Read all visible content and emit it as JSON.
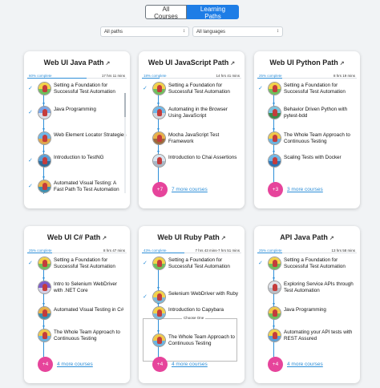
{
  "toggle": {
    "all_courses": "All Courses",
    "learning_paths": "Learning Paths"
  },
  "filters": {
    "paths": "All paths",
    "languages": "All languages"
  },
  "cards": [
    {
      "title": "Web UI Java Path",
      "complete": "60% complete",
      "progress": 0.6,
      "duration": "17 hrs 11 mins",
      "courses": [
        {
          "name": "Setting a Foundation for Successful Test Automation",
          "done": true,
          "top": "#f2d24a",
          "bot": "#6fbf5b"
        },
        {
          "name": "Java Programming",
          "done": true,
          "top": "#7aa6e8",
          "bot": "#d9dfe8"
        },
        {
          "name": "Web Element Locator Strategies",
          "done": false,
          "top": "#6fb8e8",
          "bot": "#e0a64a"
        },
        {
          "name": "Introduction to TestNG",
          "done": true,
          "top": "#5aa0d8",
          "bot": "#2f6b9a"
        },
        {
          "name": "Automated Visual Testing: A Fast Path To Test Automation",
          "done": true,
          "top": "#e8b24a",
          "bot": "#3b8fb0"
        }
      ],
      "more": ""
    },
    {
      "title": "Web UI JavaScript Path",
      "complete": "18% complete",
      "progress": 0.18,
      "duration": "14 hrs 41 mins",
      "courses": [
        {
          "name": "Setting a Foundation for Successful Test Automation",
          "done": true,
          "top": "#f2d24a",
          "bot": "#6fbf5b"
        },
        {
          "name": "Automating in the Browser Using JavaScript",
          "done": false,
          "top": "#6fb8e8",
          "bot": "#d0d7df"
        },
        {
          "name": "Mocha JavaScript Test Framework",
          "done": false,
          "top": "#e8b24a",
          "bot": "#9d6b3b"
        },
        {
          "name": "Introduction to Chai Assertions",
          "done": false,
          "top": "#d6e3ee",
          "bot": "#a7b7c6"
        }
      ],
      "more": "+7",
      "more_label": "7 more courses"
    },
    {
      "title": "Web UI Python Path",
      "complete": "25% complete",
      "progress": 0.25,
      "duration": "8 hrs 19 mins",
      "courses": [
        {
          "name": "Setting a Foundation for Successful Test Automation",
          "done": true,
          "top": "#f2d24a",
          "bot": "#6fbf5b"
        },
        {
          "name": "Behavior Driven Python with pytest-bdd",
          "done": false,
          "top": "#7bc5e0",
          "bot": "#3d8b4a"
        },
        {
          "name": "The Whole Team Approach to Continuous Testing",
          "done": false,
          "top": "#f0c84a",
          "bot": "#6ab4e0"
        },
        {
          "name": "Scaling Tests with Docker",
          "done": false,
          "top": "#6fb8e8",
          "bot": "#2c73b5"
        }
      ],
      "more": "+3",
      "more_label": "3 more courses"
    },
    {
      "title": "Web UI C# Path",
      "complete": "25% complete",
      "progress": 0.25,
      "duration": "8 hrs 47 mins",
      "courses": [
        {
          "name": "Setting a Foundation for Successful Test Automation",
          "done": true,
          "top": "#f2d24a",
          "bot": "#6fbf5b"
        },
        {
          "name": "Intro to Selenium WebDriver with .NET Core",
          "done": false,
          "top": "#7c5ac8",
          "bot": "#d2d0e8"
        },
        {
          "name": "Automated Visual Testing in C#",
          "done": false,
          "top": "#e8b24a",
          "bot": "#3b8fb0"
        },
        {
          "name": "The Whole Team Approach to Continuous Testing",
          "done": false,
          "top": "#f0c84a",
          "bot": "#6ab4e0"
        }
      ],
      "more": "+4",
      "more_label": "4 more courses"
    },
    {
      "title": "Web UI Ruby Path",
      "complete": "43% complete",
      "progress": 0.43,
      "duration": "7 hrs 43 mins-7 hrs 51 mins",
      "choose": "Choose One",
      "courses": [
        {
          "name": "Setting a Foundation for Successful Test Automation",
          "done": true,
          "top": "#f2d24a",
          "bot": "#6fbf5b"
        },
        {
          "name": "Selenium WebDriver with Ruby",
          "done": true,
          "top": "#f2d24a",
          "bot": "#7cb9d8"
        },
        {
          "name": "Introduction to Capybara",
          "done": false,
          "top": "#f2d24a",
          "bot": "#7cb9d8"
        },
        {
          "name": "The Whole Team Approach to Continuous Testing",
          "done": false,
          "top": "#f0c84a",
          "bot": "#6ab4e0"
        }
      ],
      "more": "+4",
      "more_label": "4 more courses"
    },
    {
      "title": "API Java Path",
      "complete": "25% complete",
      "progress": 0.25,
      "duration": "13 hrs 58 mins",
      "courses": [
        {
          "name": "Setting a Foundation for Successful Test Automation",
          "done": true,
          "top": "#f2d24a",
          "bot": "#6fbf5b"
        },
        {
          "name": "Exploring Service APIs through Test Automation",
          "done": false,
          "top": "#e0e4ea",
          "bot": "#b9c0c8"
        },
        {
          "name": "Java Programming",
          "done": false,
          "top": "#f0c84a",
          "bot": "#6fbf5b"
        },
        {
          "name": "Automating your API tests with REST Assured",
          "done": false,
          "top": "#f2d24a",
          "bot": "#5aa0d8"
        }
      ],
      "more": "+4",
      "more_label": "4 more courses"
    }
  ]
}
